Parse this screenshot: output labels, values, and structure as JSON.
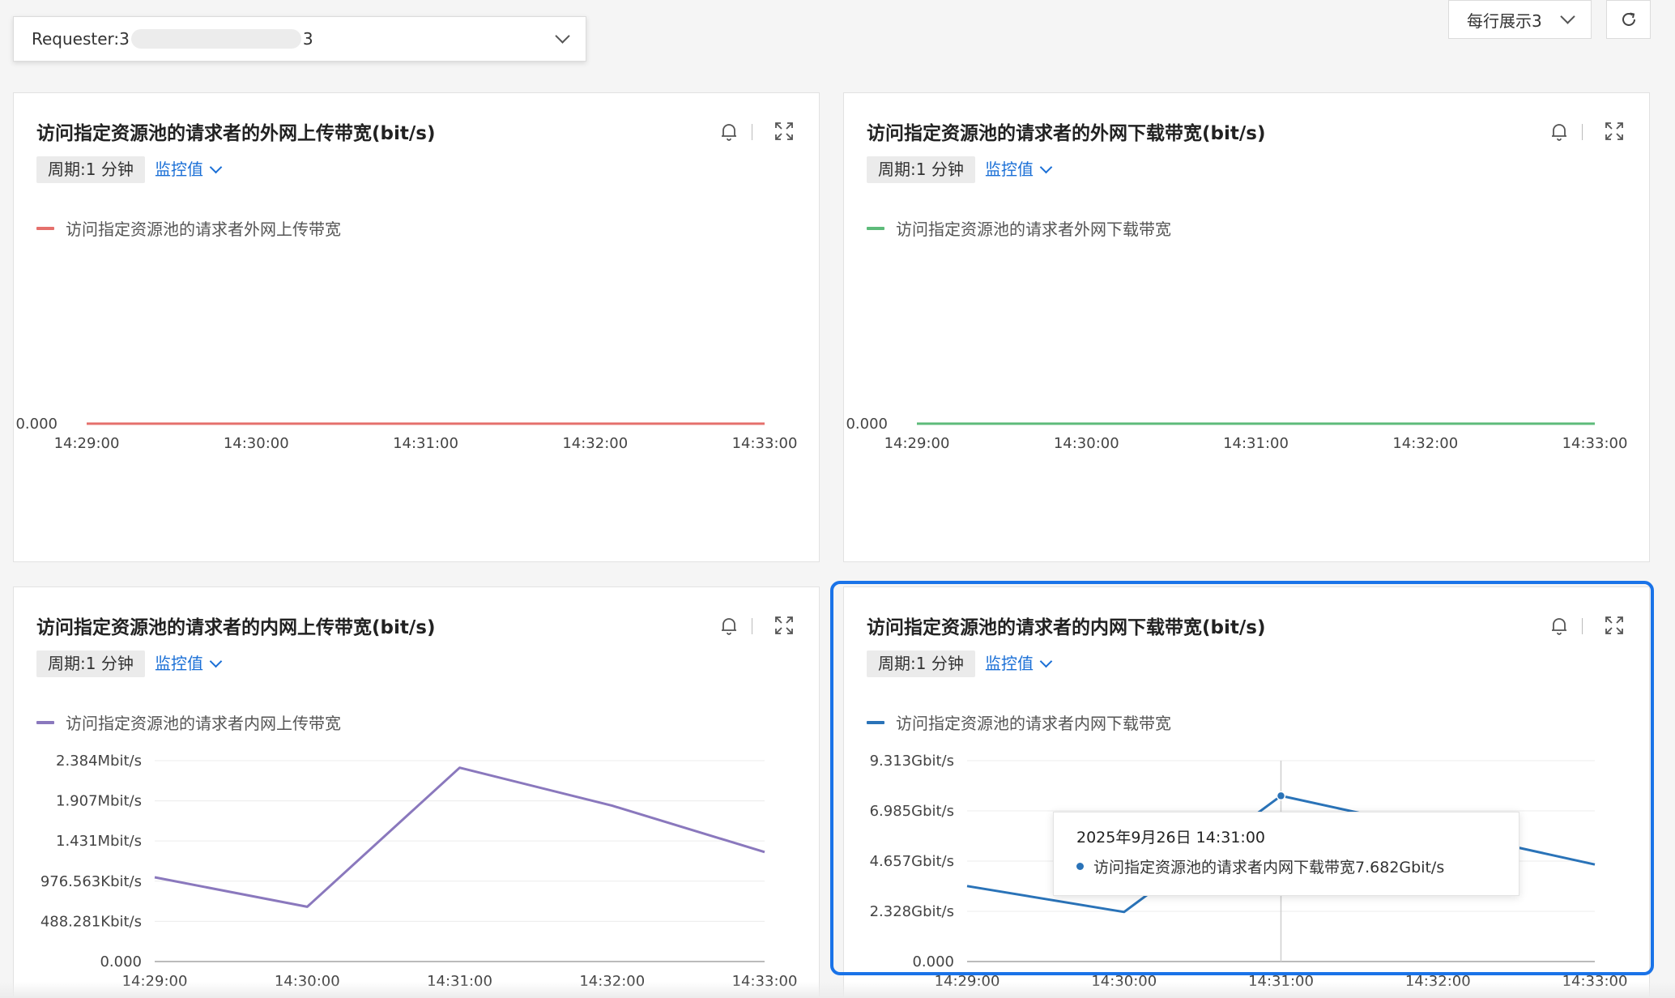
{
  "requester_select": {
    "prefix": "Requester:3",
    "suffix": "3"
  },
  "per_row": {
    "label": "每行展示3"
  },
  "cards": [
    {
      "title": "访问指定资源池的请求者的外网上传带宽(bit/s)",
      "period": "周期:1 分钟",
      "metric": "监控值",
      "legend": "访问指定资源池的请求者外网上传带宽",
      "color": "#e5706c"
    },
    {
      "title": "访问指定资源池的请求者的外网下载带宽(bit/s)",
      "period": "周期:1 分钟",
      "metric": "监控值",
      "legend": "访问指定资源池的请求者外网下载带宽",
      "color": "#5dbb7a"
    },
    {
      "title": "访问指定资源池的请求者的内网上传带宽(bit/s)",
      "period": "周期:1 分钟",
      "metric": "监控值",
      "legend": "访问指定资源池的请求者内网上传带宽",
      "color": "#8a78bd"
    },
    {
      "title": "访问指定资源池的请求者的内网下载带宽(bit/s)",
      "period": "周期:1 分钟",
      "metric": "监控值",
      "legend": "访问指定资源池的请求者内网下载带宽",
      "color": "#2a73b8"
    }
  ],
  "tooltip": {
    "time": "2025年9月26日 14:31:00",
    "series": "访问指定资源池的请求者内网下载带宽",
    "value": "7.682Gbit/s"
  },
  "chart_data": [
    {
      "type": "line",
      "x": [
        "14:29:00",
        "14:30:00",
        "14:31:00",
        "14:32:00",
        "14:33:00"
      ],
      "series": [
        {
          "name": "访问指定资源池的请求者外网上传带宽",
          "values": [
            0,
            0,
            0,
            0,
            0
          ]
        }
      ],
      "yticks": [
        "0.000"
      ],
      "ylim": [
        0,
        1
      ]
    },
    {
      "type": "line",
      "x": [
        "14:29:00",
        "14:30:00",
        "14:31:00",
        "14:32:00",
        "14:33:00"
      ],
      "series": [
        {
          "name": "访问指定资源池的请求者外网下载带宽",
          "values": [
            0,
            0,
            0,
            0,
            0
          ]
        }
      ],
      "yticks": [
        "0.000"
      ],
      "ylim": [
        0,
        1
      ]
    },
    {
      "type": "line",
      "x": [
        "14:29:00",
        "14:30:00",
        "14:31:00",
        "14:32:00",
        "14:33:00"
      ],
      "series": [
        {
          "name": "访问指定资源池的请求者内网上传带宽",
          "values": [
            1.0,
            0.65,
            2.3,
            1.85,
            1.3
          ]
        }
      ],
      "yticks": [
        "0.000",
        "488.281Kbit/s",
        "976.563Kbit/s",
        "1.431Mbit/s",
        "1.907Mbit/s",
        "2.384Mbit/s"
      ],
      "ytick_values": [
        0,
        0.4768,
        0.9537,
        1.431,
        1.907,
        2.384
      ],
      "yunit": "Mbit/s",
      "ylim": [
        0,
        2.384
      ]
    },
    {
      "type": "line",
      "x": [
        "14:29:00",
        "14:30:00",
        "14:31:00",
        "14:32:00",
        "14:33:00"
      ],
      "series": [
        {
          "name": "访问指定资源池的请求者内网下载带宽",
          "values": [
            3.5,
            2.3,
            7.682,
            6.1,
            4.5
          ]
        }
      ],
      "yticks": [
        "0.000",
        "2.328Gbit/s",
        "4.657Gbit/s",
        "6.985Gbit/s",
        "9.313Gbit/s"
      ],
      "ytick_values": [
        0,
        2.328,
        4.657,
        6.985,
        9.313
      ],
      "yunit": "Gbit/s",
      "ylim": [
        0,
        9.313
      ],
      "hover_index": 2
    }
  ]
}
